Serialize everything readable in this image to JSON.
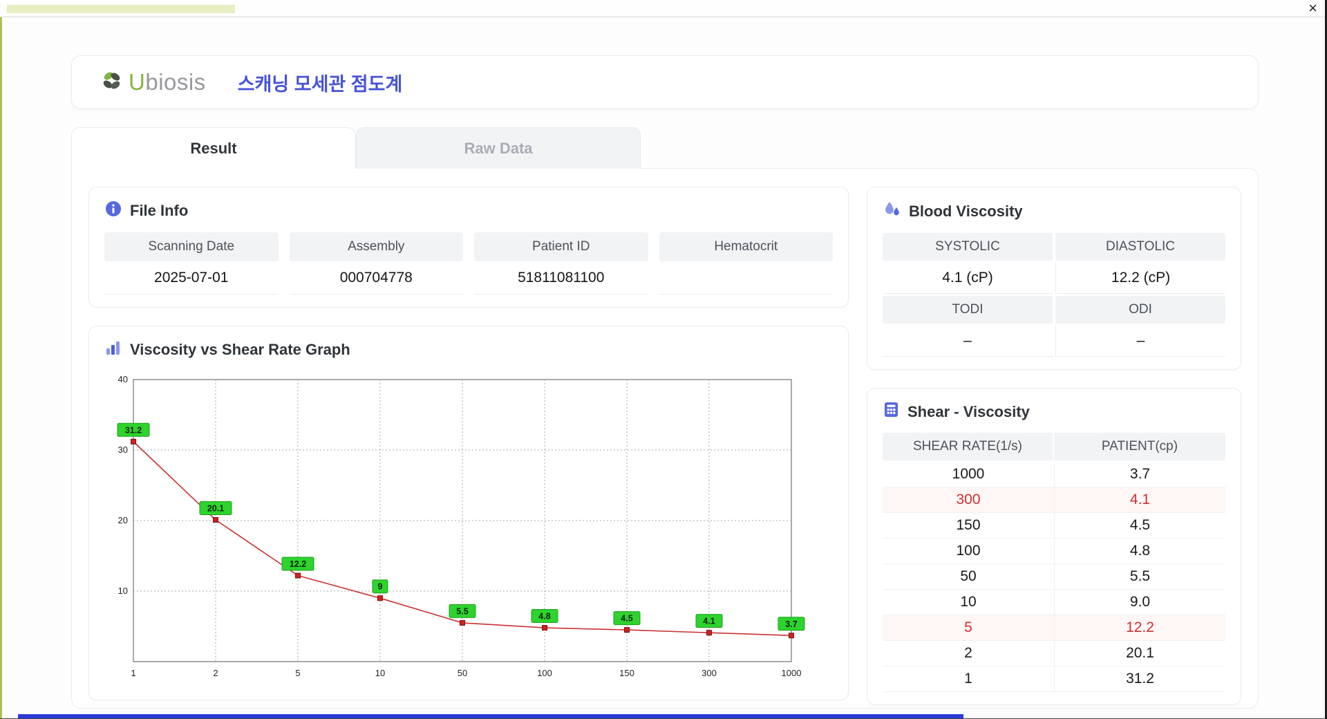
{
  "window": {
    "close_label": "×"
  },
  "header": {
    "logo_u": "U",
    "logo_rest": "biosis",
    "title": "스캐닝 모세관 점도계"
  },
  "tabs": [
    {
      "label": "Result",
      "active": true
    },
    {
      "label": "Raw Data",
      "active": false
    }
  ],
  "file_info": {
    "title": "File Info",
    "fields": [
      {
        "label": "Scanning Date",
        "value": "2025-07-01"
      },
      {
        "label": "Assembly",
        "value": "000704778"
      },
      {
        "label": "Patient ID",
        "value": "51811081100"
      },
      {
        "label": "Hematocrit",
        "value": ""
      }
    ]
  },
  "graph": {
    "title": "Viscosity vs Shear Rate Graph"
  },
  "chart_data": {
    "type": "line",
    "title": "Viscosity vs Shear Rate Graph",
    "x_ticks": [
      "1",
      "2",
      "5",
      "10",
      "50",
      "100",
      "150",
      "300",
      "1000"
    ],
    "values": [
      31.2,
      20.1,
      12.2,
      9,
      5.5,
      4.8,
      4.5,
      4.1,
      3.7
    ],
    "labels": [
      "31.2",
      "20.1",
      "12.2",
      "9",
      "5.5",
      "4.8",
      "4.5",
      "4.1",
      "3.7"
    ],
    "y_ticks": [
      10,
      20,
      30,
      40
    ],
    "ylim": [
      0,
      40
    ],
    "xlabel": "",
    "ylabel": "",
    "grid": true,
    "x_scale": "categorical",
    "line_color": "#c83232",
    "marker_color": "#cc2222",
    "label_bg": "#2ed32e",
    "label_border": "#1f9e1f"
  },
  "blood_viscosity": {
    "title": "Blood Viscosity",
    "rows": [
      {
        "headers": [
          "SYSTOLIC",
          "DIASTOLIC"
        ],
        "values": [
          "4.1 (cP)",
          "12.2 (cP)"
        ]
      },
      {
        "headers": [
          "TODI",
          "ODI"
        ],
        "values": [
          "–",
          "–"
        ]
      }
    ]
  },
  "shear_viscosity": {
    "title": "Shear - Viscosity",
    "columns": [
      "SHEAR RATE(1/s)",
      "PATIENT(cp)"
    ],
    "rows": [
      {
        "shear": "1000",
        "patient": "3.7",
        "highlight": false
      },
      {
        "shear": "300",
        "patient": "4.1",
        "highlight": true
      },
      {
        "shear": "150",
        "patient": "4.5",
        "highlight": false
      },
      {
        "shear": "100",
        "patient": "4.8",
        "highlight": false
      },
      {
        "shear": "50",
        "patient": "5.5",
        "highlight": false
      },
      {
        "shear": "10",
        "patient": "9.0",
        "highlight": false
      },
      {
        "shear": "5",
        "patient": "12.2",
        "highlight": true
      },
      {
        "shear": "2",
        "patient": "20.1",
        "highlight": false
      },
      {
        "shear": "1",
        "patient": "31.2",
        "highlight": false
      }
    ]
  },
  "colors": {
    "accent_blue": "#4653d5",
    "icon_blue": "#5568dd",
    "icon_blue_light": "#8a97e8",
    "logo_green": "#85b440",
    "red_text": "#d12f2f",
    "header_bg": "#f2f3f5",
    "chart_line": "#c83232",
    "chart_label_bg": "#2ed32e"
  }
}
